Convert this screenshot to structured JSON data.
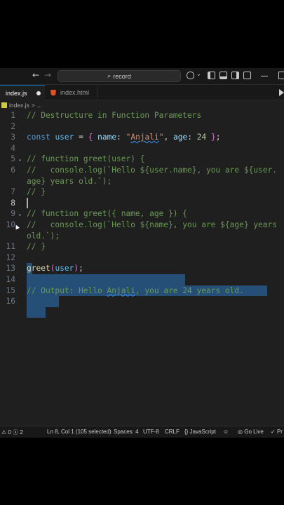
{
  "titlebar": {
    "back_glyph": "←",
    "forward_glyph": "→",
    "search_text": "record",
    "search_icon": "search-icon"
  },
  "tabs": [
    {
      "label": "index.js",
      "active": true,
      "dirty": true
    },
    {
      "label": "index.html",
      "active": false
    }
  ],
  "breadcrumb": {
    "file": "index.js",
    "sep": ">",
    "more": "..."
  },
  "editor": {
    "cursor_line": 8,
    "line_numbers": [
      "1",
      "2",
      "3",
      "4",
      "5",
      "6",
      "",
      "7",
      "8",
      "9",
      "10",
      "",
      "11",
      "12",
      "13",
      "14",
      "15",
      "16"
    ]
  },
  "statusbar": {
    "problems": "0",
    "warnings": "2",
    "position": "Ln 8, Col 1 (105 selected)",
    "spaces": "Spaces: 4",
    "encoding": "UTF-8",
    "eol": "CRLF",
    "language": "JavaScript",
    "golive": "Go Live",
    "prettier": "Pr"
  },
  "colors": {
    "selection": "#264f78",
    "comment": "#6a9955",
    "keyword": "#569cd6",
    "string": "#ce9178",
    "accent": "#0078d4"
  }
}
